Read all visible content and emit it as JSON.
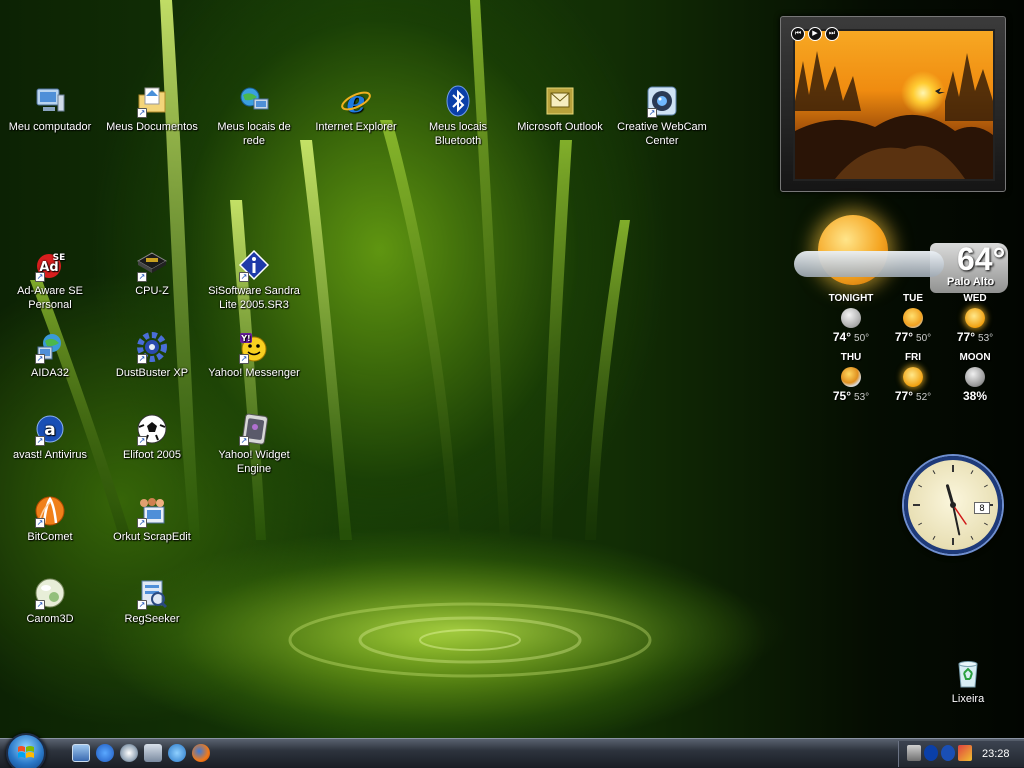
{
  "desktop": {
    "icons": [
      {
        "label": "Meu computador",
        "icon": "computer-icon",
        "shortcut": false
      },
      {
        "label": "Meus Documentos",
        "icon": "documents-folder-icon",
        "shortcut": false
      },
      {
        "label": "Meus locais de rede",
        "icon": "network-places-icon",
        "shortcut": false
      },
      {
        "label": "Internet Explorer",
        "icon": "internet-explorer-icon",
        "shortcut": false
      },
      {
        "label": "Meus locais Bluetooth",
        "icon": "bluetooth-icon",
        "shortcut": false
      },
      {
        "label": "Microsoft Outlook",
        "icon": "outlook-icon",
        "shortcut": false
      },
      {
        "label": "Creative WebCam Center",
        "icon": "webcam-icon",
        "shortcut": true
      },
      {
        "label": "Ad-Aware SE Personal",
        "icon": "ad-aware-icon",
        "shortcut": true
      },
      {
        "label": "CPU-Z",
        "icon": "cpu-chip-icon",
        "shortcut": true
      },
      {
        "label": "SiSoftware Sandra Lite 2005.SR3",
        "icon": "sandra-info-icon",
        "shortcut": true
      },
      {
        "label": "AIDA32",
        "icon": "aida32-icon",
        "shortcut": true
      },
      {
        "label": "DustBuster XP",
        "icon": "dustbuster-gear-icon",
        "shortcut": true
      },
      {
        "label": "Yahoo! Messenger",
        "icon": "yahoo-messenger-icon",
        "shortcut": true
      },
      {
        "label": "avast! Antivirus",
        "icon": "avast-icon",
        "shortcut": true
      },
      {
        "label": "Elifoot 2005",
        "icon": "soccer-ball-icon",
        "shortcut": true
      },
      {
        "label": "Yahoo! Widget Engine",
        "icon": "widget-engine-icon",
        "shortcut": true
      },
      {
        "label": "BitComet",
        "icon": "bitcomet-icon",
        "shortcut": true
      },
      {
        "label": "Orkut ScrapEdit",
        "icon": "orkut-scrapedit-icon",
        "shortcut": true
      },
      {
        "label": "Carom3D",
        "icon": "carom-ball-icon",
        "shortcut": true
      },
      {
        "label": "RegSeeker",
        "icon": "regseeker-icon",
        "shortcut": true
      },
      {
        "label": "Lixeira",
        "icon": "recycle-bin-icon",
        "shortcut": false
      }
    ]
  },
  "photo_gadget": {
    "controls": [
      "⏮",
      "▶",
      "⏭"
    ]
  },
  "weather": {
    "current_temp": "64°",
    "city": "Palo Alto",
    "forecast": [
      {
        "day": "TONIGHT",
        "hi": "74°",
        "lo": "50°",
        "icon": "moon-icon"
      },
      {
        "day": "TUE",
        "hi": "77°",
        "lo": "50°",
        "icon": "partly-sunny-icon"
      },
      {
        "day": "WED",
        "hi": "77°",
        "lo": "53°",
        "icon": "sunny-icon"
      },
      {
        "day": "THU",
        "hi": "75°",
        "lo": "53°",
        "icon": "partly-cloudy-icon"
      },
      {
        "day": "FRI",
        "hi": "77°",
        "lo": "52°",
        "icon": "sunny-icon"
      },
      {
        "day": "MOON",
        "hi": "38%",
        "lo": "",
        "icon": "moon-phase-icon"
      }
    ]
  },
  "clock": {
    "date": "8",
    "hour": 11,
    "minute": 28
  },
  "taskbar": {
    "quick_launch": [
      "show-desktop-icon",
      "internet-explorer-icon",
      "media-player-icon",
      "messenger-icon",
      "search-icon",
      "firefox-icon"
    ],
    "tray_icons": [
      "network-icon",
      "bluetooth-tray-icon",
      "avast-tray-icon",
      "security-tray-icon"
    ],
    "time": "23:28"
  },
  "colors": {
    "ie_blue": "#1f7be0",
    "bluetooth_blue": "#0a3fa8",
    "outlook_gold": "#b8a23c",
    "yahoo_purple": "#6b1fa0",
    "avast_orange": "#e8631c",
    "bitcomet_orange": "#f0801a"
  }
}
